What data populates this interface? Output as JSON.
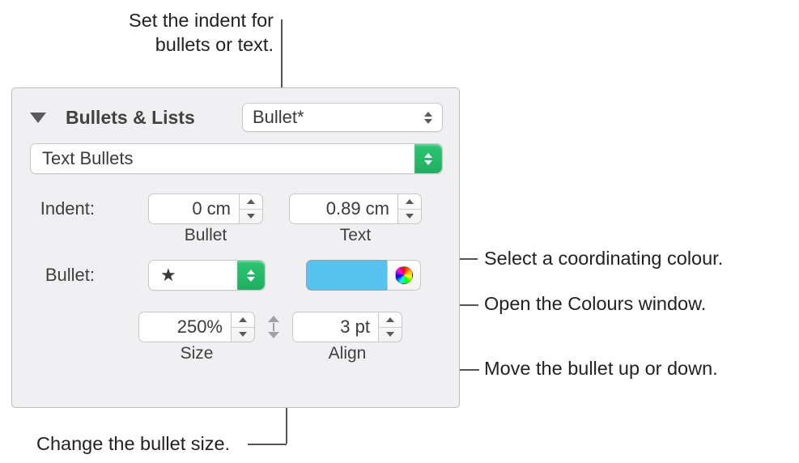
{
  "callouts": {
    "top": "Set the indent for\nbullets or text.",
    "right1": "Select a coordinating colour.",
    "right2": "Open the Colours window.",
    "right3": "Move the bullet up or down.",
    "bottom": "Change the bullet size."
  },
  "panel": {
    "section_title": "Bullets & Lists",
    "style_popup": "Bullet*",
    "type_popup": "Text Bullets",
    "indent": {
      "label": "Indent:",
      "bullet_value": "0 cm",
      "bullet_sublabel": "Bullet",
      "text_value": "0.89 cm",
      "text_sublabel": "Text"
    },
    "bullet": {
      "label": "Bullet:",
      "glyph": "★",
      "color": "#55c3ed"
    },
    "size": {
      "value": "250%",
      "sublabel": "Size"
    },
    "align": {
      "value": "3 pt",
      "sublabel": "Align"
    }
  }
}
